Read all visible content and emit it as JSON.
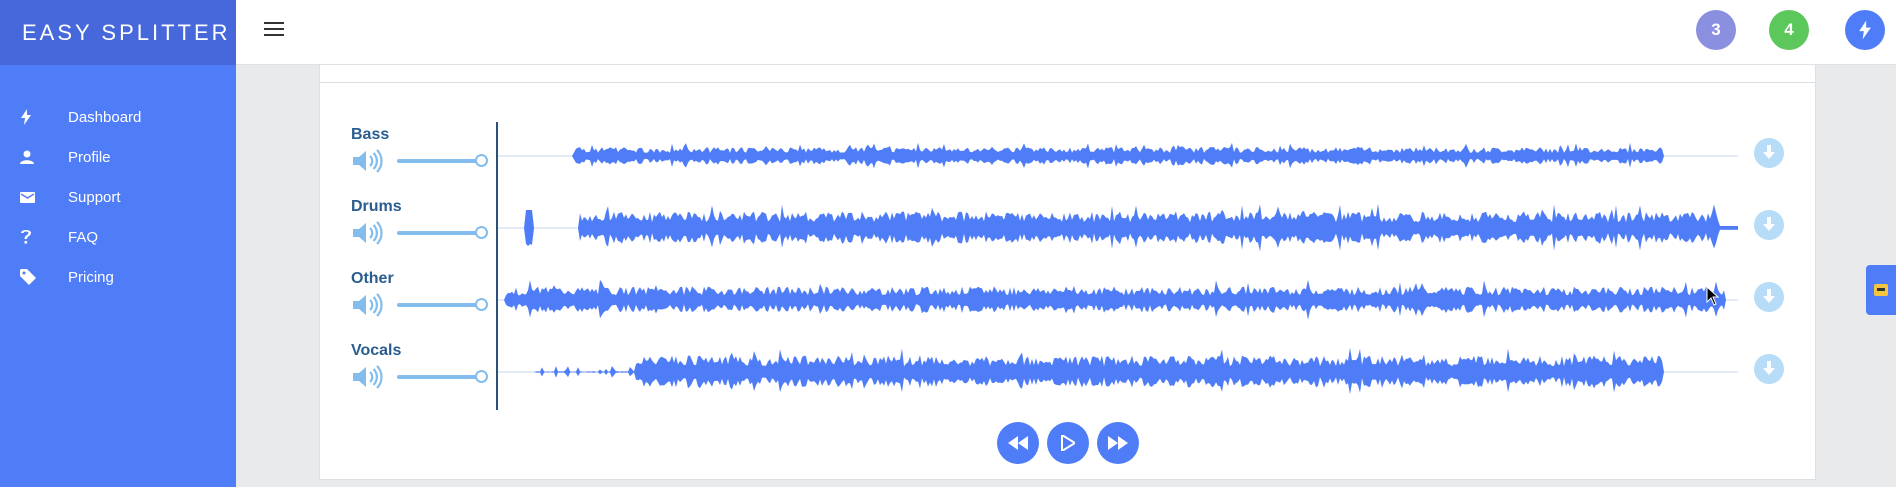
{
  "brand": {
    "name": "EASY SPLITTER"
  },
  "sidebar": {
    "items": [
      {
        "label": "Dashboard",
        "icon": "bolt-icon"
      },
      {
        "label": "Profile",
        "icon": "user-icon"
      },
      {
        "label": "Support",
        "icon": "envelope-icon"
      },
      {
        "label": "FAQ",
        "icon": "question-icon"
      },
      {
        "label": "Pricing",
        "icon": "tag-icon"
      }
    ]
  },
  "header": {
    "badges": [
      {
        "value": "3",
        "color": "#8a8fe0"
      },
      {
        "value": "4",
        "color": "#5cc85c"
      }
    ],
    "action_icon": "bolt-icon"
  },
  "tracks": [
    {
      "name": "Bass",
      "volume": 1.0
    },
    {
      "name": "Drums",
      "volume": 1.0
    },
    {
      "name": "Other",
      "volume": 1.0
    },
    {
      "name": "Vocals",
      "volume": 1.0
    }
  ],
  "player": {
    "controls": [
      "rewind-icon",
      "play-icon",
      "fast-forward-icon"
    ]
  },
  "colors": {
    "accent": "#4f7cf7",
    "brand_bar": "#4668da",
    "wave": "#4f7cf7",
    "label": "#2a5d8f",
    "muted_blue": "#83bdee"
  }
}
